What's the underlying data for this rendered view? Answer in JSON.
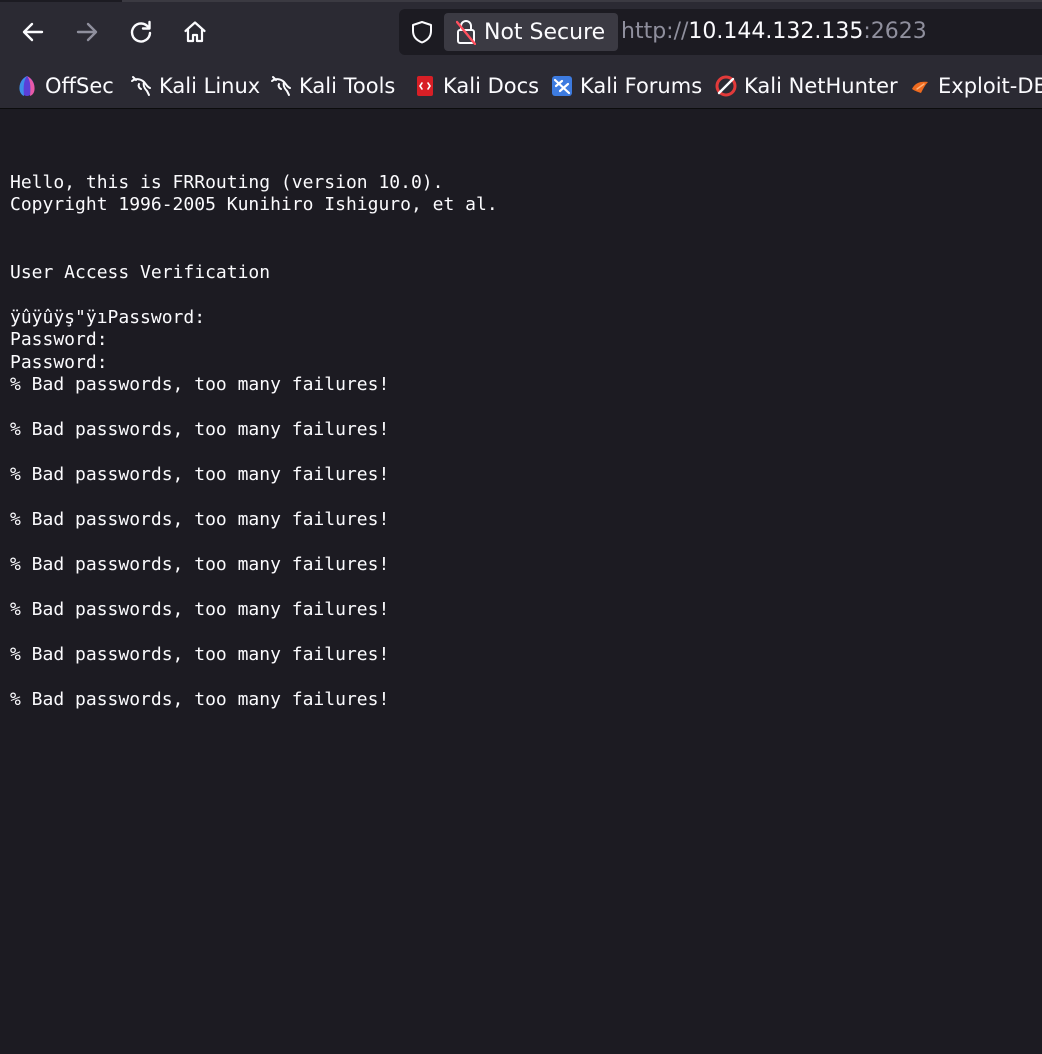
{
  "toolbar": {
    "security_label": "Not Secure",
    "url_scheme": "http://",
    "url_host": "10.144.132.135",
    "url_port": ":2623"
  },
  "bookmarks": [
    {
      "label": "OffSec",
      "icon": "offsec-icon"
    },
    {
      "label": "Kali Linux",
      "icon": "kali-dragon-icon"
    },
    {
      "label": "Kali Tools",
      "icon": "kali-dragon-icon"
    },
    {
      "label": "Kali Docs",
      "icon": "kali-docs-icon"
    },
    {
      "label": "Kali Forums",
      "icon": "kali-forums-icon"
    },
    {
      "label": "Kali NetHunter",
      "icon": "nethunter-icon"
    },
    {
      "label": "Exploit-DB",
      "icon": "exploitdb-icon"
    }
  ],
  "terminal": {
    "lines": [
      "",
      "Hello, this is FRRouting (version 10.0).",
      "Copyright 1996-2005 Kunihiro Ishiguro, et al.",
      "",
      "",
      "User Access Verification",
      "",
      "ÿû\u0001ÿû\u0003ÿş\"ÿı\u001fPassword:",
      "Password:",
      "Password:",
      "% Bad passwords, too many failures!",
      "",
      "% Bad passwords, too many failures!",
      "",
      "% Bad passwords, too many failures!",
      "",
      "% Bad passwords, too many failures!",
      "",
      "% Bad passwords, too many failures!",
      "",
      "% Bad passwords, too many failures!",
      "",
      "% Bad passwords, too many failures!",
      "",
      "% Bad passwords, too many failures!"
    ]
  },
  "colors": {
    "toolbar_bg": "#2b2a33",
    "content_bg": "#1c1b22",
    "text": "#fbfbfe"
  }
}
